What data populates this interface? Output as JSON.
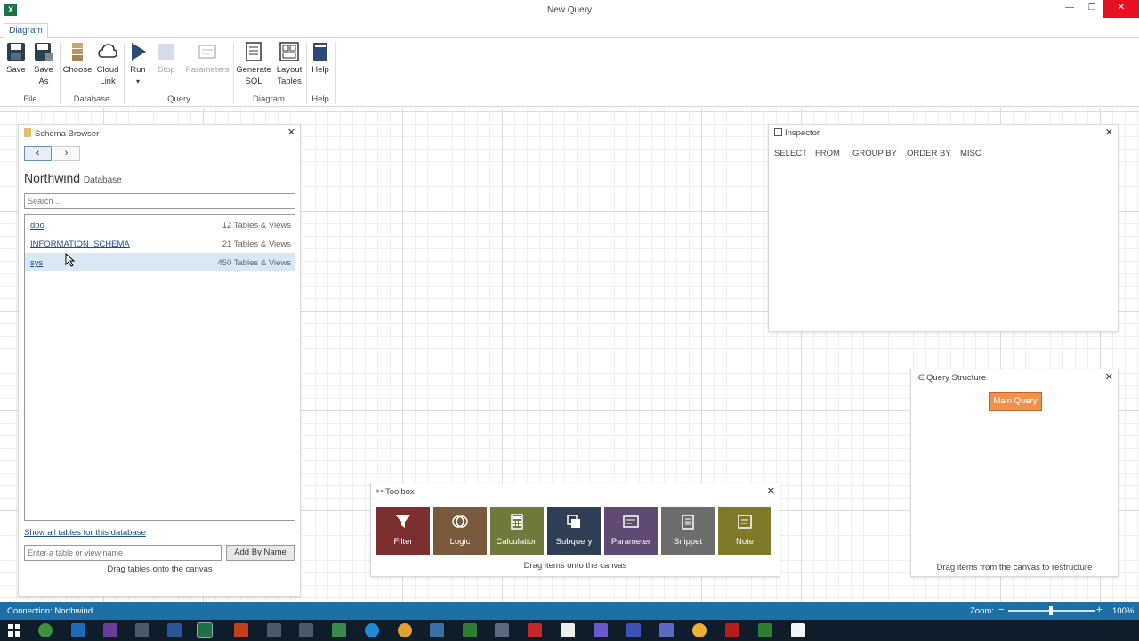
{
  "window": {
    "title": "New Query",
    "app_icon": "X",
    "minimize": "—",
    "maximize": "❐",
    "close": "✕"
  },
  "ribbon": {
    "tab": "Diagram",
    "buttons": {
      "save": "Save",
      "save_as_1": "Save",
      "save_as_2": "As",
      "choose": "Choose",
      "cloud_1": "Cloud",
      "cloud_2": "Link",
      "run": "Run",
      "stop": "Stop",
      "parameters": "Parameters",
      "generate_1": "Generate",
      "generate_2": "SQL",
      "layout_1": "Layout",
      "layout_2": "Tables",
      "help": "Help"
    },
    "groups": {
      "file": "File",
      "database": "Database",
      "query": "Query",
      "diagram": "Diagram",
      "help": "Help"
    }
  },
  "schema_browser": {
    "title": "Schema Browser",
    "back": "‹",
    "forward": "›",
    "db_name": "Northwind",
    "db_suffix": "Database",
    "search_placeholder": "Search ...",
    "schemas": [
      {
        "name": "dbo",
        "count": "12 Tables & Views"
      },
      {
        "name": "INFORMATION_SCHEMA",
        "count": "21 Tables & Views"
      },
      {
        "name": "sys",
        "count": "450 Tables & Views"
      }
    ],
    "show_all_link": "Show all tables for this database",
    "table_input_placeholder": "Enter a table or view name",
    "add_button": "Add By Name",
    "hint": "Drag tables onto the canvas"
  },
  "inspector": {
    "title": "Inspector",
    "tabs": [
      "SELECT",
      "FROM",
      "GROUP BY",
      "ORDER BY",
      "MISC"
    ]
  },
  "query_structure": {
    "title": "Query Structure",
    "main_query": "Main Query",
    "hint": "Drag items from the canvas to restructure"
  },
  "toolbox": {
    "title": "Toolbox",
    "items": [
      {
        "label": "Filter",
        "color": "#7b2f2f"
      },
      {
        "label": "Logic",
        "color": "#7a5a3c"
      },
      {
        "label": "Calculation",
        "color": "#6f7a3c"
      },
      {
        "label": "Subquery",
        "color": "#2f3e55"
      },
      {
        "label": "Parameter",
        "color": "#5e4a72"
      },
      {
        "label": "Snippet",
        "color": "#6d6d6d"
      },
      {
        "label": "Note",
        "color": "#7f7a2a"
      }
    ],
    "hint": "Drag items onto the canvas"
  },
  "status": {
    "connection": "Connection: Northwind",
    "zoom_label": "Zoom:",
    "zoom_value": "100%",
    "zoom_minus": "−",
    "zoom_plus": "+"
  },
  "colors": {
    "status_bar": "#1d6fa5",
    "taskbar": "#0f1d2b",
    "main_query": "#f0924c"
  }
}
